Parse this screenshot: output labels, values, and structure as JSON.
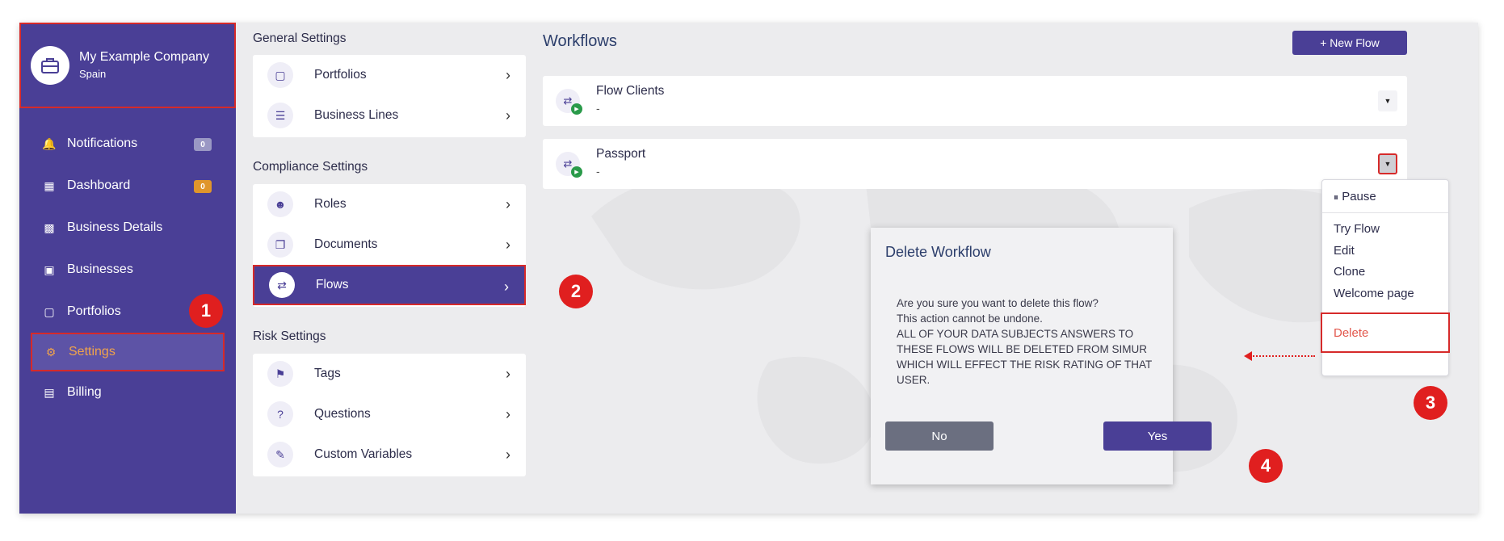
{
  "company": {
    "name": "My Example Company",
    "country": "Spain"
  },
  "sidebar": {
    "items": [
      {
        "label": "Notifications",
        "icon": "bell-icon",
        "badge": "0",
        "badge_color": "#9a98c4"
      },
      {
        "label": "Dashboard",
        "icon": "dashboard-icon",
        "badge": "0",
        "badge_color": "#e0962b"
      },
      {
        "label": "Business Details",
        "icon": "id-badge-icon"
      },
      {
        "label": "Businesses",
        "icon": "building-search-icon"
      },
      {
        "label": "Portfolios",
        "icon": "briefcase-icon"
      },
      {
        "label": "Settings",
        "icon": "gear-icon",
        "active": true
      },
      {
        "label": "Billing",
        "icon": "invoice-icon"
      }
    ]
  },
  "settings": {
    "general": {
      "title": "General Settings",
      "items": [
        {
          "label": "Portfolios",
          "icon": "briefcase-icon"
        },
        {
          "label": "Business Lines",
          "icon": "org-chart-icon"
        }
      ]
    },
    "compliance": {
      "title": "Compliance Settings",
      "items": [
        {
          "label": "Roles",
          "icon": "user-tie-icon"
        },
        {
          "label": "Documents",
          "icon": "documents-icon"
        },
        {
          "label": "Flows",
          "icon": "flow-icon",
          "active": true
        }
      ]
    },
    "risk": {
      "title": "Risk Settings",
      "items": [
        {
          "label": "Tags",
          "icon": "tag-icon"
        },
        {
          "label": "Questions",
          "icon": "question-icon"
        },
        {
          "label": "Custom Variables",
          "icon": "edit-icon"
        }
      ]
    }
  },
  "workflows": {
    "title": "Workflows",
    "new_button": "+ New Flow",
    "flows": [
      {
        "name": "Flow Clients",
        "sub": "-"
      },
      {
        "name": "Passport",
        "sub": "-"
      }
    ]
  },
  "menu": {
    "pause": "Pause",
    "items": [
      "Try Flow",
      "Edit",
      "Clone",
      "Welcome page"
    ],
    "delete": "Delete"
  },
  "dialog": {
    "title": "Delete Workflow",
    "lines": [
      "Are you sure you want to delete this flow?",
      "This action cannot be undone.",
      "ALL OF YOUR DATA SUBJECTS ANSWERS TO",
      "THESE FLOWS WILL BE DELETED FROM SIMUR",
      "WHICH WILL EFFECT THE RISK RATING OF THAT",
      "USER."
    ],
    "no": "No",
    "yes": "Yes"
  },
  "markers": [
    "1",
    "2",
    "3",
    "4"
  ]
}
